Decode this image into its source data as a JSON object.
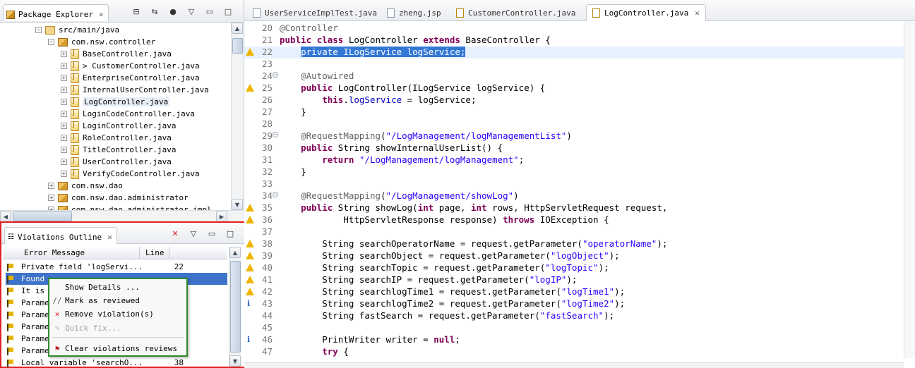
{
  "package_explorer": {
    "title": "Package Explorer",
    "items": [
      {
        "label": "src/main/java",
        "indent": 2,
        "type": "folder",
        "expanded": true
      },
      {
        "label": "com.nsw.controller",
        "indent": 3,
        "type": "package",
        "expanded": true
      },
      {
        "label": "BaseController.java",
        "indent": 4,
        "type": "java"
      },
      {
        "label": "> CustomerController.java",
        "indent": 4,
        "type": "java"
      },
      {
        "label": "EnterpriseController.java",
        "indent": 4,
        "type": "java"
      },
      {
        "label": "InternalUserController.java",
        "indent": 4,
        "type": "java"
      },
      {
        "label": "LogController.java",
        "indent": 4,
        "type": "java",
        "selected": true
      },
      {
        "label": "LoginCodeController.java",
        "indent": 4,
        "type": "java"
      },
      {
        "label": "LoginController.java",
        "indent": 4,
        "type": "java"
      },
      {
        "label": "RoleController.java",
        "indent": 4,
        "type": "java"
      },
      {
        "label": "TitleController.java",
        "indent": 4,
        "type": "java"
      },
      {
        "label": "UserController.java",
        "indent": 4,
        "type": "java"
      },
      {
        "label": "VerifyCodeController.java",
        "indent": 4,
        "type": "java"
      },
      {
        "label": "com.nsw.dao",
        "indent": 3,
        "type": "package"
      },
      {
        "label": "com.nsw.dao.administrator",
        "indent": 3,
        "type": "package"
      },
      {
        "label": "com.nsw.dao.administrator.impl",
        "indent": 3,
        "type": "package"
      }
    ]
  },
  "violations": {
    "title": "Violations Outline",
    "col_error": "Error Message",
    "col_line": "Line",
    "rows": [
      {
        "msg": "Private field 'logServi...",
        "line": "22"
      },
      {
        "msg": "Found",
        "line": "",
        "selected": true
      },
      {
        "msg": "It is",
        "line": ""
      },
      {
        "msg": "Parame",
        "line": ""
      },
      {
        "msg": "Parame",
        "line": ""
      },
      {
        "msg": "Parame",
        "line": ""
      },
      {
        "msg": "Parame",
        "line": ""
      },
      {
        "msg": "Parame",
        "line": ""
      },
      {
        "msg": "Local variable 'searchO...",
        "line": "38"
      }
    ]
  },
  "context_menu": {
    "items": [
      {
        "label": "Show Details ...",
        "icon": "none"
      },
      {
        "label": "Mark as reviewed",
        "icon": "mark-reviewed-icon"
      },
      {
        "label": "Remove violation(s)",
        "icon": "red-x-icon"
      },
      {
        "label": "Quick fix...",
        "icon": "quick-fix-icon",
        "disabled": true
      },
      {
        "label": "Clear violations reviews",
        "icon": "red-flag-icon"
      }
    ]
  },
  "editor": {
    "tabs": [
      {
        "label": "UserServiceImplTest.java",
        "active": false
      },
      {
        "label": "zheng.jsp",
        "active": false
      },
      {
        "label": "CustomerController.java",
        "active": false
      },
      {
        "label": "LogController.java",
        "active": true
      }
    ],
    "lines": [
      {
        "n": "20",
        "text": "@Controller",
        "cls": "an",
        "marker": "",
        "fold": ""
      },
      {
        "n": "21",
        "text": "public class LogController extends BaseController {",
        "cls": "",
        "marker": "",
        "fold": ""
      },
      {
        "n": "22",
        "text": "    private ILogService logService;",
        "cls": "",
        "marker": "warn",
        "fold": "",
        "hl": true
      },
      {
        "n": "23",
        "text": "",
        "cls": "",
        "marker": "",
        "fold": ""
      },
      {
        "n": "24",
        "text": "    @Autowired",
        "cls": "an",
        "marker": "",
        "fold": "-"
      },
      {
        "n": "25",
        "text": "    public LogController(ILogService logService) {",
        "cls": "",
        "marker": "warn",
        "fold": ""
      },
      {
        "n": "26",
        "text": "        this.logService = logService;",
        "cls": "",
        "marker": "",
        "fold": ""
      },
      {
        "n": "27",
        "text": "    }",
        "cls": "",
        "marker": "",
        "fold": ""
      },
      {
        "n": "28",
        "text": "",
        "cls": "",
        "marker": "",
        "fold": ""
      },
      {
        "n": "29",
        "text": "    @RequestMapping(\"/LogManagement/logManagementList\")",
        "cls": "",
        "marker": "",
        "fold": "-"
      },
      {
        "n": "30",
        "text": "    public String showInternalUserList() {",
        "cls": "",
        "marker": "",
        "fold": ""
      },
      {
        "n": "31",
        "text": "        return \"/LogManagement/logManagement\";",
        "cls": "",
        "marker": "",
        "fold": ""
      },
      {
        "n": "32",
        "text": "    }",
        "cls": "",
        "marker": "",
        "fold": ""
      },
      {
        "n": "33",
        "text": "",
        "cls": "",
        "marker": "",
        "fold": ""
      },
      {
        "n": "34",
        "text": "    @RequestMapping(\"/LogManagement/showLog\")",
        "cls": "",
        "marker": "",
        "fold": "-"
      },
      {
        "n": "35",
        "text": "    public String showLog(int page, int rows, HttpServletRequest request,",
        "cls": "",
        "marker": "warn",
        "fold": ""
      },
      {
        "n": "36",
        "text": "            HttpServletResponse response) throws IOException {",
        "cls": "",
        "marker": "warn",
        "fold": ""
      },
      {
        "n": "37",
        "text": "",
        "cls": "",
        "marker": "",
        "fold": ""
      },
      {
        "n": "38",
        "text": "        String searchOperatorName = request.getParameter(\"operatorName\");",
        "cls": "",
        "marker": "warn",
        "fold": ""
      },
      {
        "n": "39",
        "text": "        String searchObject = request.getParameter(\"logObject\");",
        "cls": "",
        "marker": "warn",
        "fold": ""
      },
      {
        "n": "40",
        "text": "        String searchTopic = request.getParameter(\"logTopic\");",
        "cls": "",
        "marker": "warn",
        "fold": ""
      },
      {
        "n": "41",
        "text": "        String searchIP = request.getParameter(\"logIP\");",
        "cls": "",
        "marker": "warn",
        "fold": ""
      },
      {
        "n": "42",
        "text": "        String searchlogTime1 = request.getParameter(\"logTime1\");",
        "cls": "",
        "marker": "warn",
        "fold": ""
      },
      {
        "n": "43",
        "text": "        String searchlogTime2 = request.getParameter(\"logTime2\");",
        "cls": "",
        "marker": "info",
        "fold": ""
      },
      {
        "n": "44",
        "text": "        String fastSearch = request.getParameter(\"fastSearch\");",
        "cls": "",
        "marker": "",
        "fold": ""
      },
      {
        "n": "45",
        "text": "",
        "cls": "",
        "marker": "",
        "fold": ""
      },
      {
        "n": "46",
        "text": "        PrintWriter writer = null;",
        "cls": "",
        "marker": "info",
        "fold": ""
      },
      {
        "n": "47",
        "text": "        try {",
        "cls": "",
        "marker": "",
        "fold": ""
      }
    ]
  },
  "colors": {
    "keyword": "#7f0055",
    "string": "#2a00ff",
    "annotation": "#646464",
    "field": "#0000c0",
    "selection": "#3478d6",
    "highlight_box": "#e02020",
    "menu_box": "#2f8a2f"
  }
}
